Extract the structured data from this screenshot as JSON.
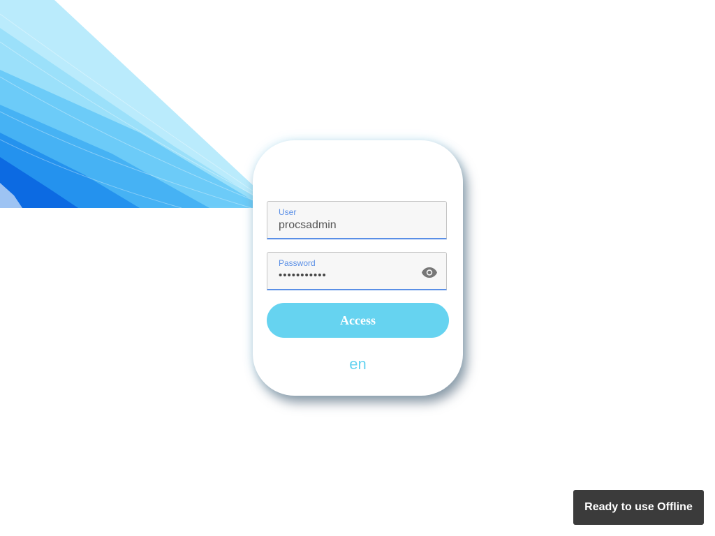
{
  "login": {
    "user_label": "User",
    "user_value": "procsadmin",
    "password_label": "Password",
    "password_value": "•••••••••••",
    "access_label": "Access",
    "language": "en"
  },
  "toast": {
    "message": "Ready to use Offline"
  },
  "icons": {
    "password_toggle": "eye-icon"
  },
  "colors": {
    "accent": "#66d3f0",
    "field_focus": "#5a8fe6",
    "toast_bg": "#3b3b3b"
  }
}
